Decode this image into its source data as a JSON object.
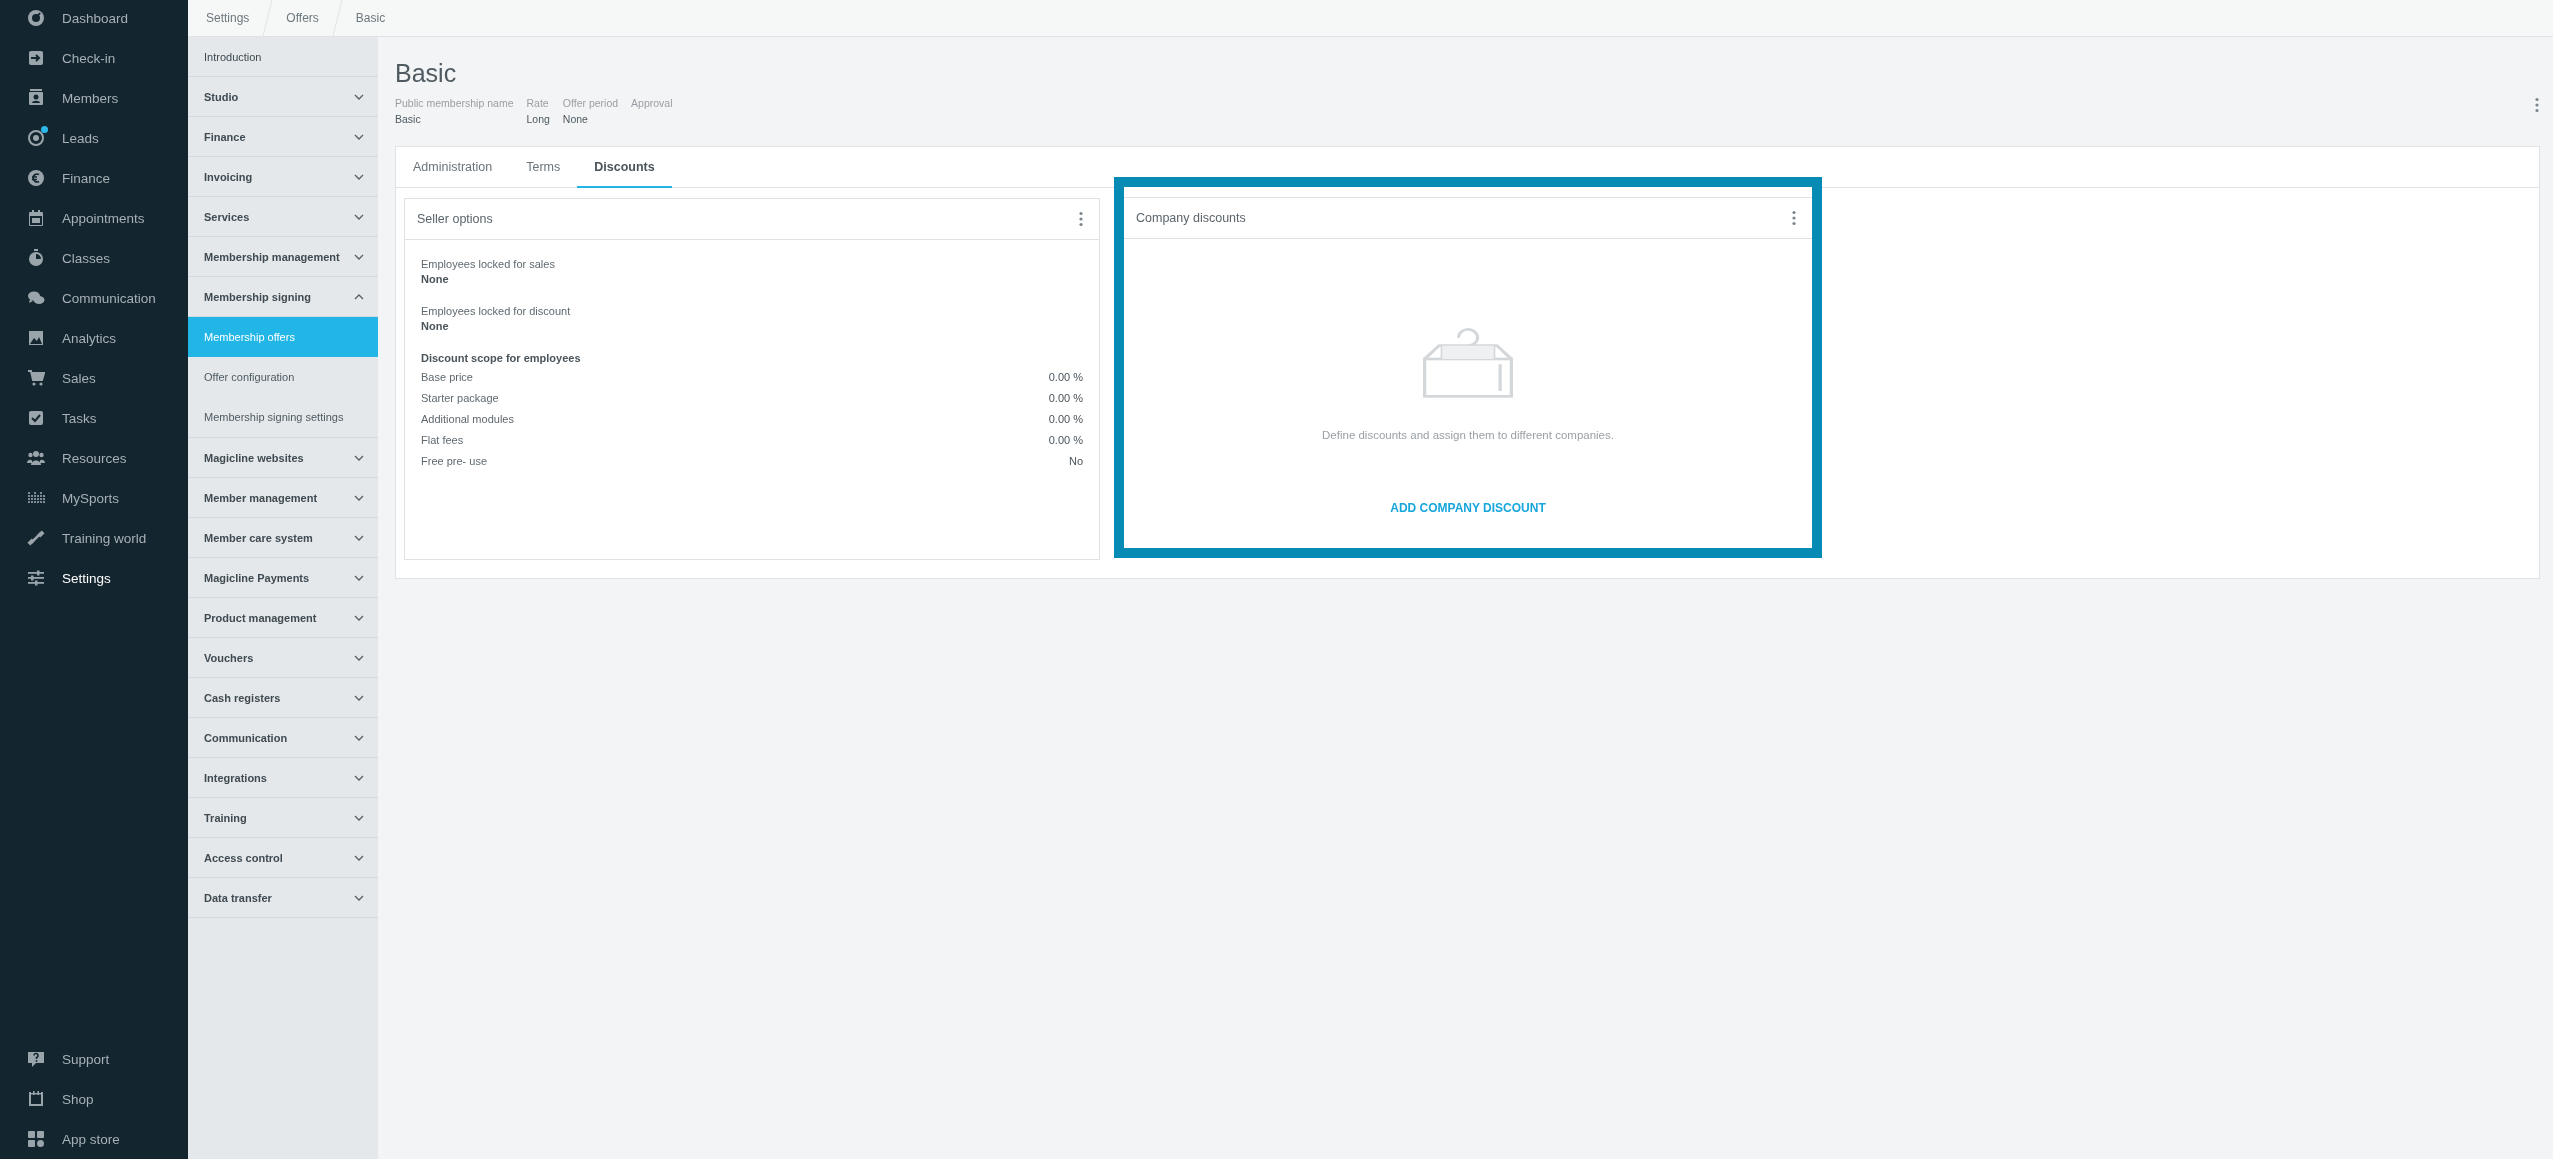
{
  "nav": {
    "items": [
      {
        "label": "Dashboard",
        "selected": false,
        "notification": false
      },
      {
        "label": "Check-in",
        "selected": false,
        "notification": false
      },
      {
        "label": "Members",
        "selected": false,
        "notification": false
      },
      {
        "label": "Leads",
        "selected": false,
        "notification": true
      },
      {
        "label": "Finance",
        "selected": false,
        "notification": false
      },
      {
        "label": "Appointments",
        "selected": false,
        "notification": false
      },
      {
        "label": "Classes",
        "selected": false,
        "notification": false
      },
      {
        "label": "Communication",
        "selected": false,
        "notification": false
      },
      {
        "label": "Analytics",
        "selected": false,
        "notification": false
      },
      {
        "label": "Sales",
        "selected": false,
        "notification": false
      },
      {
        "label": "Tasks",
        "selected": false,
        "notification": false
      },
      {
        "label": "Resources",
        "selected": false,
        "notification": false
      },
      {
        "label": "MySports",
        "selected": false,
        "notification": false
      },
      {
        "label": "Training world",
        "selected": false,
        "notification": false
      },
      {
        "label": "Settings",
        "selected": true,
        "notification": false
      }
    ],
    "bottom_items": [
      {
        "label": "Support"
      },
      {
        "label": "Shop"
      },
      {
        "label": "App store"
      }
    ]
  },
  "breadcrumb": [
    "Settings",
    "Offers",
    "Basic"
  ],
  "settings_menu": [
    {
      "label": "Introduction",
      "kind": "link"
    },
    {
      "label": "Studio",
      "kind": "group",
      "expanded": false
    },
    {
      "label": "Finance",
      "kind": "group",
      "expanded": false
    },
    {
      "label": "Invoicing",
      "kind": "group",
      "expanded": false
    },
    {
      "label": "Services",
      "kind": "group",
      "expanded": false
    },
    {
      "label": "Membership management",
      "kind": "group",
      "expanded": false
    },
    {
      "label": "Membership signing",
      "kind": "group",
      "expanded": true,
      "children": [
        {
          "label": "Membership offers",
          "selected": true
        },
        {
          "label": "Offer configuration",
          "selected": false
        },
        {
          "label": "Membership signing settings",
          "selected": false
        }
      ]
    },
    {
      "label": "Magicline websites",
      "kind": "group",
      "expanded": false
    },
    {
      "label": "Member management",
      "kind": "group",
      "expanded": false
    },
    {
      "label": "Member care system",
      "kind": "group",
      "expanded": false
    },
    {
      "label": "Magicline Payments",
      "kind": "group",
      "expanded": false
    },
    {
      "label": "Product management",
      "kind": "group",
      "expanded": false
    },
    {
      "label": "Vouchers",
      "kind": "group",
      "expanded": false
    },
    {
      "label": "Cash registers",
      "kind": "group",
      "expanded": false
    },
    {
      "label": "Communication",
      "kind": "group",
      "expanded": false
    },
    {
      "label": "Integrations",
      "kind": "group",
      "expanded": false
    },
    {
      "label": "Training",
      "kind": "group",
      "expanded": false
    },
    {
      "label": "Access control",
      "kind": "group",
      "expanded": false
    },
    {
      "label": "Data transfer",
      "kind": "group",
      "expanded": false
    }
  ],
  "page": {
    "title": "Basic",
    "fields": [
      {
        "label": "Public membership name",
        "value": "Basic"
      },
      {
        "label": "Rate",
        "value": "Long"
      },
      {
        "label": "Offer period",
        "value": "None"
      },
      {
        "label": "Approval"
      }
    ]
  },
  "tabs": [
    {
      "label": "Administration",
      "selected": false
    },
    {
      "label": "Terms",
      "selected": false
    },
    {
      "label": "Discounts",
      "selected": true
    }
  ],
  "seller_options": {
    "title": "Seller options",
    "locks": [
      {
        "label": "Employees locked for sales",
        "value": "None"
      },
      {
        "label": "Employees locked for discount",
        "value": "None"
      }
    ],
    "scope_title": "Discount scope for employees",
    "scope": [
      {
        "label": "Base price",
        "value": "0.00 %"
      },
      {
        "label": "Starter package",
        "value": "0.00 %"
      },
      {
        "label": "Additional modules",
        "value": "0.00 %"
      },
      {
        "label": "Flat fees",
        "value": "0.00 %"
      },
      {
        "label": "Free pre- use",
        "value": "No"
      }
    ]
  },
  "company_discounts": {
    "title": "Company discounts",
    "highlighted": true,
    "empty_text": "Define discounts and assign them to different companies.",
    "action": "ADD COMPANY DISCOUNT"
  }
}
